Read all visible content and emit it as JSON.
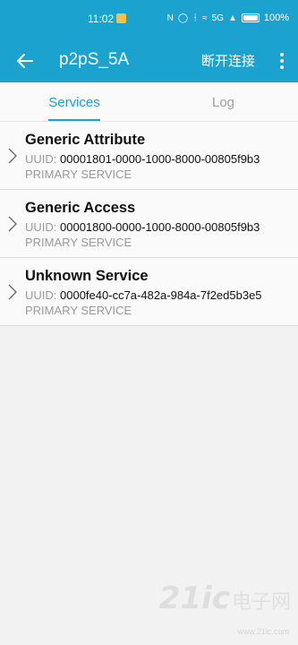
{
  "status_bar": {
    "time": "11:02",
    "network_type": "5G",
    "battery_percent": "100%",
    "icons": [
      "nfc-icon",
      "mute-icon",
      "bluetooth-icon",
      "wifi-icon",
      "signal-icon",
      "battery-icon"
    ]
  },
  "app_bar": {
    "title": "p2pS_5A",
    "disconnect_label": "断开连接",
    "accent_color": "#1ba2cf"
  },
  "tabs": [
    {
      "label": "Services",
      "selected": true
    },
    {
      "label": "Log",
      "selected": false
    }
  ],
  "services": [
    {
      "name": "Generic Attribute",
      "uuid_label": "UUID:",
      "uuid": "00001801-0000-1000-8000-00805f9b3",
      "type": "PRIMARY SERVICE"
    },
    {
      "name": "Generic Access",
      "uuid_label": "UUID:",
      "uuid": "00001800-0000-1000-8000-00805f9b3",
      "type": "PRIMARY SERVICE"
    },
    {
      "name": "Unknown Service",
      "uuid_label": "UUID:",
      "uuid": "0000fe40-cc7a-482a-984a-7f2ed5b3e5",
      "type": "PRIMARY SERVICE"
    }
  ],
  "watermark": {
    "number": "21ic",
    "text": "电子网",
    "url": "www.21ic.com"
  }
}
